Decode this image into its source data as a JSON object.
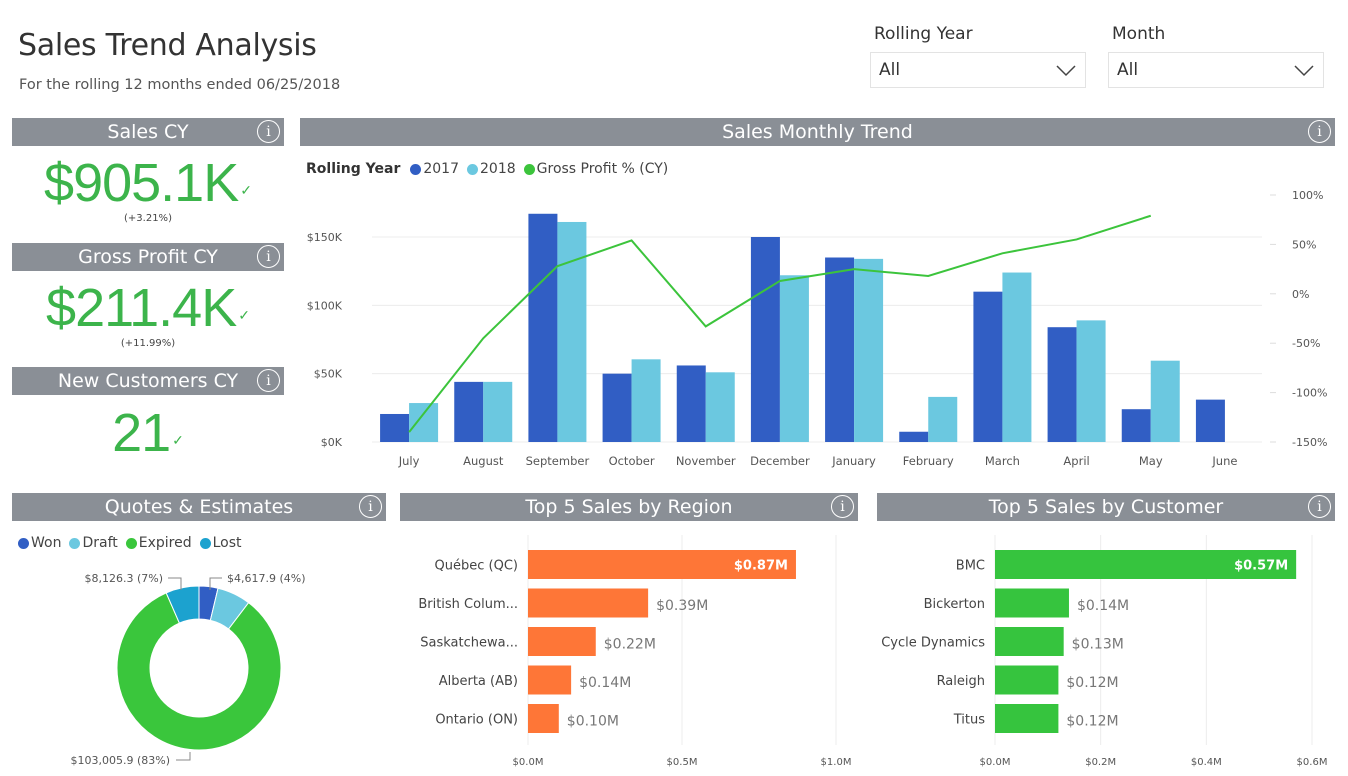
{
  "header": {
    "title": "Sales Trend Analysis",
    "subtitle": "For the rolling 12 months ended 06/25/2018"
  },
  "slicers": [
    {
      "label": "Rolling Year",
      "value": "All"
    },
    {
      "label": "Month",
      "value": "All"
    }
  ],
  "kpis": [
    {
      "title": "Sales CY",
      "value": "$905.1K",
      "change": "(+3.21%)",
      "status_icon": "check-icon"
    },
    {
      "title": "Gross Profit CY",
      "value": "$211.4K",
      "change": "(+11.99%)",
      "status_icon": "check-icon"
    },
    {
      "title": "New Customers CY",
      "value": "21",
      "status_icon": "check-icon"
    }
  ],
  "info_icon": "i",
  "check_glyph": "✓",
  "colors": {
    "header_bg": "#8a8f96",
    "kpi_green": "#3cb44b",
    "series_2017": "#315ec4",
    "series_2018": "#6bc8e0",
    "gross_profit": "#3cc43c",
    "region_bar": "#fe7637",
    "customer_bar": "#36c43e",
    "won": "#315ec4",
    "draft": "#6bc8e0",
    "expired": "#3ac63c",
    "lost": "#1ca2cf"
  },
  "chart_data": [
    {
      "id": "sales-monthly-trend",
      "type": "bar",
      "title": "Sales Monthly Trend",
      "legend_title": "Rolling Year",
      "legend_position": "top-left",
      "categories": [
        "July",
        "August",
        "September",
        "October",
        "November",
        "December",
        "January",
        "February",
        "March",
        "April",
        "May",
        "June"
      ],
      "series": [
        {
          "name": "2017",
          "type": "bar",
          "axis": "left",
          "values": [
            20.5,
            44,
            167,
            50,
            56,
            150,
            135,
            7.5,
            110,
            84,
            24,
            31
          ]
        },
        {
          "name": "2018",
          "type": "bar",
          "axis": "left",
          "values": [
            28.5,
            44,
            161,
            60.5,
            51,
            122,
            134,
            33,
            124,
            89,
            59.5,
            null
          ]
        },
        {
          "name": "Gross Profit % (CY)",
          "type": "line",
          "axis": "right",
          "values": [
            -140,
            -45,
            28,
            54,
            -33,
            13,
            25,
            18,
            41,
            55,
            79,
            null
          ]
        }
      ],
      "y_left": {
        "label": "",
        "unit": "K",
        "ticks": [
          "$0K",
          "$50K",
          "$100K",
          "$150K"
        ],
        "tick_values": [
          0,
          50,
          100,
          150
        ],
        "range": [
          0,
          150
        ]
      },
      "y_right": {
        "label": "",
        "ticks": [
          "-150%",
          "-100%",
          "-50%",
          "0%",
          "50%",
          "100%"
        ],
        "tick_values": [
          -150,
          -100,
          -50,
          0,
          50,
          100
        ],
        "range": [
          -150,
          100
        ]
      },
      "grid": true
    },
    {
      "id": "quotes-estimates",
      "type": "pie",
      "donut": true,
      "title": "Quotes & Estimates",
      "legend_position": "top-left",
      "slices": [
        {
          "name": "Won",
          "value": 4617.9,
          "label": "$4,617.9 (4%)"
        },
        {
          "name": "Draft",
          "value": 8200,
          "label": ""
        },
        {
          "name": "Expired",
          "value": 103005.9,
          "label": "$103,005.9 (83%)"
        },
        {
          "name": "Lost",
          "value": 8126.3,
          "label": "$8,126.3 (7%)"
        }
      ]
    },
    {
      "id": "top5-region",
      "type": "bar",
      "orientation": "horizontal",
      "title": "Top 5 Sales by Region",
      "categories": [
        "Québec (QC)",
        "British Colum...",
        "Saskatchewa...",
        "Alberta (AB)",
        "Ontario (ON)"
      ],
      "values": [
        0.87,
        0.39,
        0.22,
        0.14,
        0.1
      ],
      "data_labels": [
        "$0.87M",
        "$0.39M",
        "$0.22M",
        "$0.14M",
        "$0.10M"
      ],
      "x_ticks": [
        "$0.0M",
        "$0.5M",
        "$1.0M"
      ],
      "x_tick_values": [
        0,
        0.5,
        1.0
      ],
      "xlim": [
        0,
        1.0
      ],
      "grid": true
    },
    {
      "id": "top5-customer",
      "type": "bar",
      "orientation": "horizontal",
      "title": "Top 5 Sales by Customer",
      "categories": [
        "BMC",
        "Bickerton",
        "Cycle Dynamics",
        "Raleigh",
        "Titus"
      ],
      "values": [
        0.57,
        0.14,
        0.13,
        0.12,
        0.12
      ],
      "data_labels": [
        "$0.57M",
        "$0.14M",
        "$0.13M",
        "$0.12M",
        "$0.12M"
      ],
      "x_ticks": [
        "$0.0M",
        "$0.2M",
        "$0.4M",
        "$0.6M"
      ],
      "x_tick_values": [
        0,
        0.2,
        0.4,
        0.6
      ],
      "xlim": [
        0,
        0.6
      ],
      "grid": true
    }
  ]
}
